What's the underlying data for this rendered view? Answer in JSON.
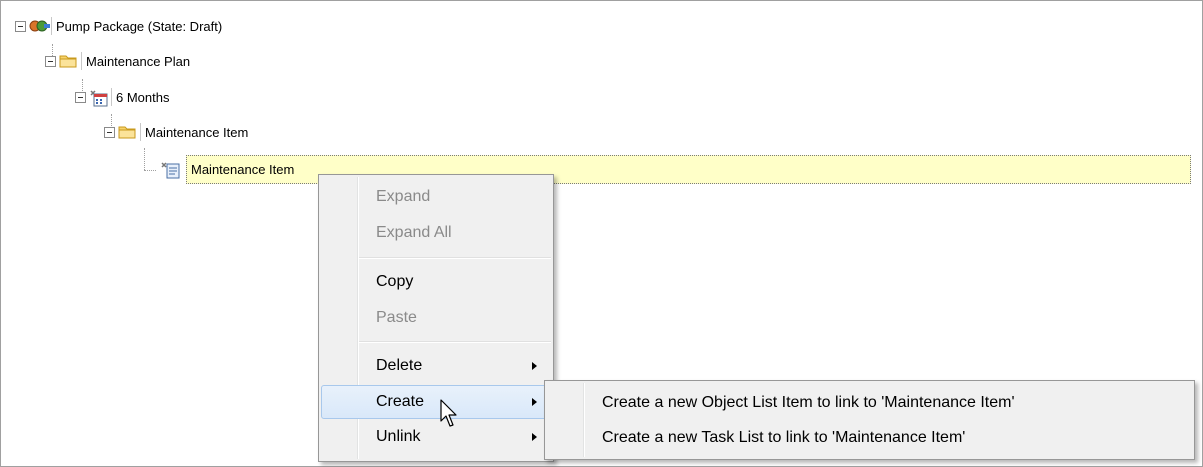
{
  "tree": {
    "nodes": [
      {
        "label": "Pump Package (State: Draft)",
        "icon": "pump-package-icon"
      },
      {
        "label": "Maintenance Plan",
        "icon": "folder-icon"
      },
      {
        "label": "6 Months",
        "icon": "schedule-icon"
      },
      {
        "label": "Maintenance Item",
        "icon": "folder-icon"
      },
      {
        "label": "Maintenance Item",
        "icon": "maintenance-item-icon"
      }
    ]
  },
  "context_menu": {
    "items": [
      {
        "label": "Expand",
        "enabled": false
      },
      {
        "label": "Expand All",
        "enabled": false
      },
      {
        "label": "Copy",
        "enabled": true
      },
      {
        "label": "Paste",
        "enabled": false
      },
      {
        "label": "Delete",
        "enabled": true,
        "submenu": true
      },
      {
        "label": "Create",
        "enabled": true,
        "submenu": true,
        "highlighted": true
      },
      {
        "label": "Unlink",
        "enabled": true,
        "submenu": true
      }
    ]
  },
  "create_submenu": {
    "items": [
      {
        "label": "Create a new Object List Item to link to 'Maintenance Item'"
      },
      {
        "label": "Create a new Task List to link to 'Maintenance Item'"
      }
    ]
  },
  "colors": {
    "selection_bg": "#ffffc8",
    "menu_bg": "#f0f0f0",
    "hover_bg": "#dce9f9",
    "folder": "#f5c542"
  }
}
